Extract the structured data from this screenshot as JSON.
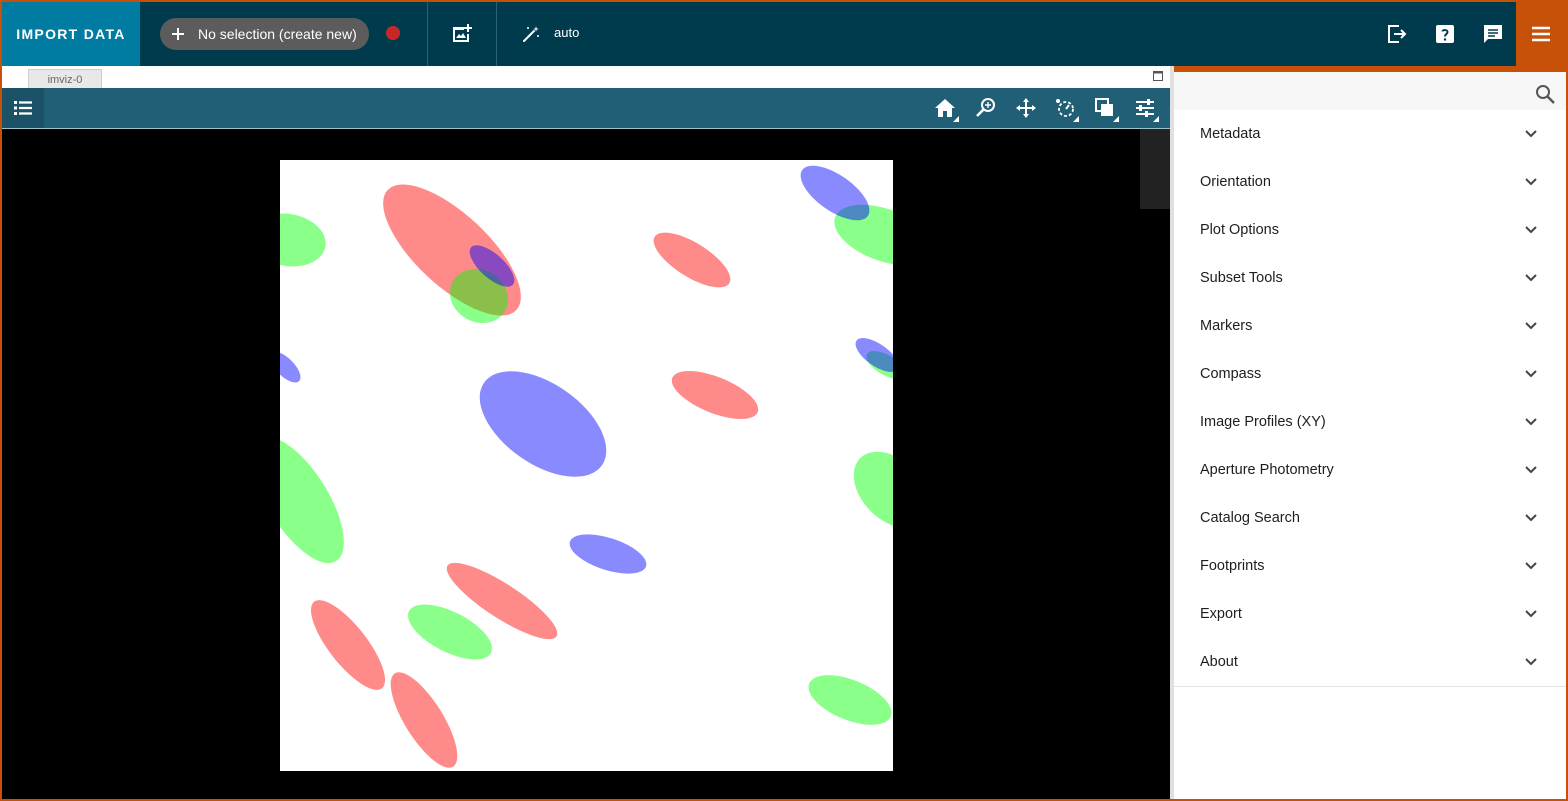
{
  "topbar": {
    "import_label": "IMPORT DATA",
    "subset_label": "No selection (create new)",
    "link_mode": "auto",
    "icons": [
      "plus-icon",
      "record-icon",
      "add-image-icon",
      "magic-wand-icon",
      "export-icon",
      "help-icon",
      "feedback-icon",
      "menu-icon"
    ],
    "colors": {
      "bar": "#003b4d",
      "import": "#007ba1",
      "accent": "#c75109",
      "record": "#c62828"
    }
  },
  "viewer": {
    "tab_label": "imviz-0",
    "tools": [
      "home-icon",
      "zoom-icon",
      "pan-icon",
      "contrast-icon",
      "blink-icon",
      "settings-icon"
    ]
  },
  "tray": {
    "plugins": [
      "Metadata",
      "Orientation",
      "Plot Options",
      "Subset Tools",
      "Markers",
      "Compass",
      "Image Profiles (XY)",
      "Aperture Photometry",
      "Catalog Search",
      "Footprints",
      "Export",
      "About"
    ]
  }
}
